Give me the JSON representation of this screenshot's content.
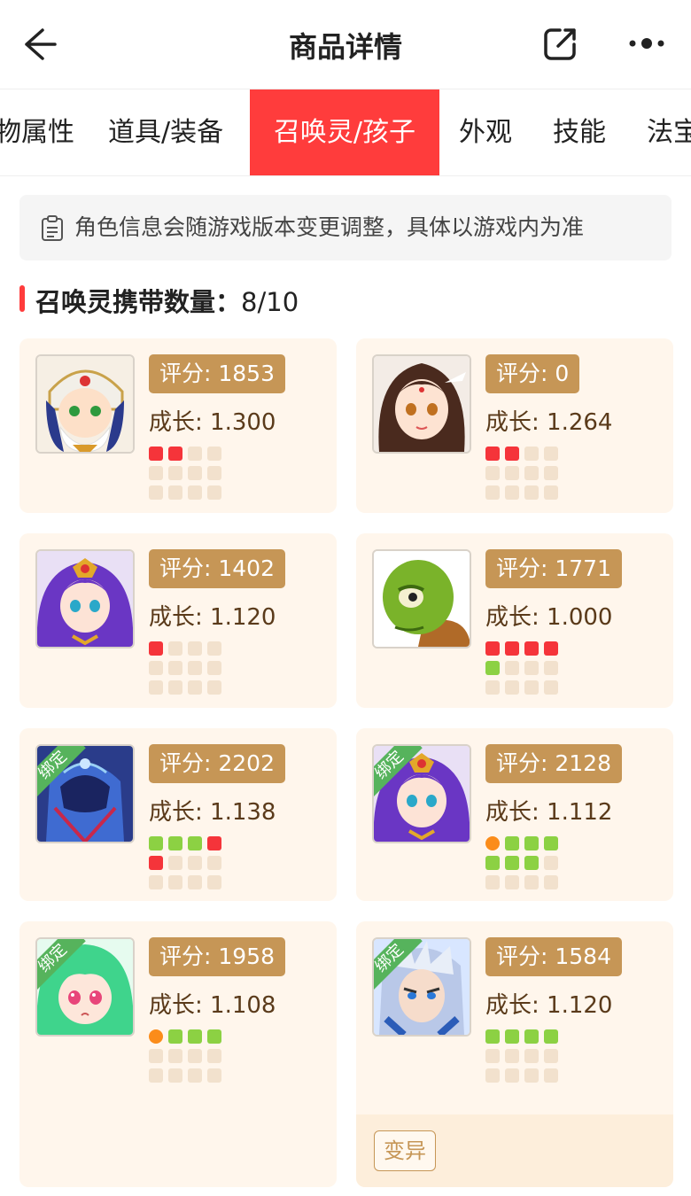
{
  "header": {
    "title": "商品详情",
    "back_icon": "arrow-left-icon",
    "share_icon": "share-icon",
    "more_icon": "more-icon"
  },
  "tabs": [
    "物属性",
    "道具/装备",
    "召唤灵/孩子",
    "外观",
    "技能",
    "法宝"
  ],
  "active_tab": 2,
  "notice": {
    "icon": "clipboard-icon",
    "text": "角色信息会随游戏版本变更调整，具体以游戏内为准"
  },
  "summon_count": {
    "label": "召唤灵携带数量：",
    "value": "8/10"
  },
  "colors": {
    "accent": "#ff3c3c",
    "score_bg": "#c69656",
    "card_bg": "#fff6ec",
    "dot_red": "#f5343a",
    "dot_green": "#8cd143",
    "dot_orange": "#fb8c1a",
    "bound_green": "#56b35c"
  },
  "pets": [
    {
      "score": "评分: 1853",
      "growth": "成长: 1.300",
      "bound": null,
      "tag": null,
      "dots": [
        "red",
        "red",
        "empty",
        "empty",
        "empty",
        "empty",
        "empty",
        "empty",
        "empty",
        "empty",
        "empty",
        "empty"
      ]
    },
    {
      "score": "评分: 0",
      "growth": "成长: 1.264",
      "bound": null,
      "tag": null,
      "dots": [
        "red",
        "red",
        "empty",
        "empty",
        "empty",
        "empty",
        "empty",
        "empty",
        "empty",
        "empty",
        "empty",
        "empty"
      ]
    },
    {
      "score": "评分: 1402",
      "growth": "成长: 1.120",
      "bound": null,
      "tag": null,
      "dots": [
        "red",
        "empty",
        "empty",
        "empty",
        "empty",
        "empty",
        "empty",
        "empty",
        "empty",
        "empty",
        "empty",
        "empty"
      ]
    },
    {
      "score": "评分: 1771",
      "growth": "成长: 1.000",
      "bound": null,
      "tag": null,
      "dots": [
        "red",
        "red",
        "red",
        "red",
        "green",
        "empty",
        "empty",
        "empty",
        "empty",
        "empty",
        "empty",
        "empty"
      ]
    },
    {
      "score": "评分: 2202",
      "growth": "成长: 1.138",
      "bound": "绑定",
      "tag": null,
      "dots": [
        "green",
        "green",
        "green",
        "red",
        "red",
        "empty",
        "empty",
        "empty",
        "empty",
        "empty",
        "empty",
        "empty"
      ]
    },
    {
      "score": "评分: 2128",
      "growth": "成长: 1.112",
      "bound": "绑定",
      "tag": null,
      "dots": [
        "orange",
        "green",
        "green",
        "green",
        "green",
        "green",
        "green",
        "empty",
        "empty",
        "empty",
        "empty",
        "empty"
      ]
    },
    {
      "score": "评分: 1958",
      "growth": "成长: 1.108",
      "bound": "绑定",
      "tag": null,
      "dots": [
        "orange",
        "green",
        "green",
        "green",
        "empty",
        "empty",
        "empty",
        "empty",
        "empty",
        "empty",
        "empty",
        "empty"
      ]
    },
    {
      "score": "评分: 1584",
      "growth": "成长: 1.120",
      "bound": "绑定",
      "tag": "变异",
      "dots": [
        "green",
        "green",
        "green",
        "green",
        "empty",
        "empty",
        "empty",
        "empty",
        "empty",
        "empty",
        "empty",
        "empty"
      ]
    }
  ]
}
